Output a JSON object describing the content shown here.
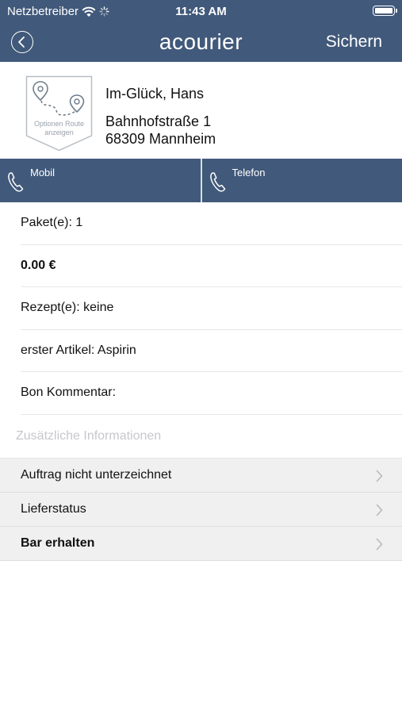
{
  "status_bar": {
    "carrier": "Netzbetreiber",
    "time": "11:43 AM"
  },
  "nav": {
    "title": "acourier",
    "save_label": "Sichern"
  },
  "customer": {
    "name": "Im-Glück, Hans",
    "street": "Bahnhofstraße 1",
    "city": "68309 Mannheim",
    "route_option_label": "Optionen Route anzeigen"
  },
  "call_buttons": [
    {
      "label": "Mobil",
      "icon": "phone-icon"
    },
    {
      "label": "Telefon",
      "icon": "phone-icon"
    }
  ],
  "details": {
    "packages": "Paket(e): 1",
    "amount": "0.00 €",
    "prescriptions": "Rezept(e): keine",
    "first_item": "erster Artikel: Aspirin",
    "receipt_comment": "Bon Kommentar:"
  },
  "section_header": "Zusätzliche Informationen",
  "menu_items": [
    {
      "label": "Auftrag nicht unterzeichnet"
    },
    {
      "label": "Lieferstatus"
    },
    {
      "label": "Bar erhalten"
    }
  ],
  "colors": {
    "brand": "#41597a",
    "section_header": "#c7c7cc",
    "menu_background": "#f0f0f0"
  }
}
